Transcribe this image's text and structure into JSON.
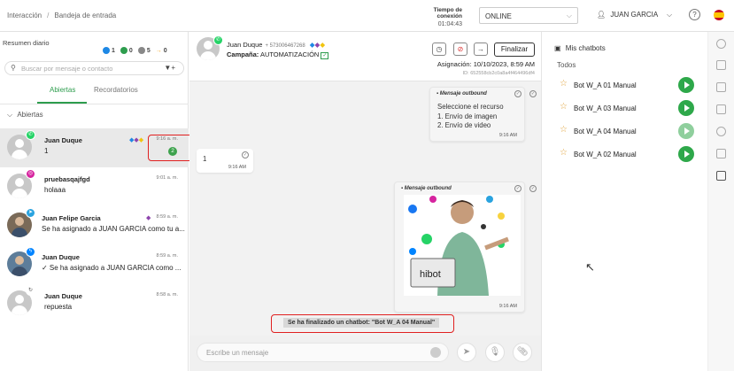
{
  "topbar": {
    "breadcrumb": [
      "Interacción",
      "Bandeja de entrada"
    ],
    "connection_label": "Tiempo de conexión",
    "connection_time": "01:04:43",
    "status": "ONLINE",
    "user": "JUAN GARCIA",
    "help": "?"
  },
  "left": {
    "summary_title": "Resumen diario",
    "counts": [
      {
        "value": "1",
        "color": "#1e88e5"
      },
      {
        "value": "0",
        "color": "#2e9d4e"
      },
      {
        "value": "5",
        "color": "#888888"
      },
      {
        "value": "0",
        "color": "#f5a623"
      }
    ],
    "search_placeholder": "Buscar por mensaje o contacto",
    "tabs": [
      "Abiertas",
      "Recordatorios"
    ],
    "section": "Abiertas",
    "conversations": [
      {
        "name": "Juan Duque",
        "message": "1",
        "time": "9:16 a. m.",
        "channel": "whatsapp",
        "unread": "2"
      },
      {
        "name": "pruebasqajfgd",
        "message": "holaaa",
        "time": "9:01 a. m.",
        "channel": "instagram"
      },
      {
        "name": "Juan Felipe Garcia",
        "message": "Se ha asignado a JUAN GARCIA como tu a...",
        "time": "8:59 a. m.",
        "channel": "telegram"
      },
      {
        "name": "Juan Duque",
        "message": "✓ Se ha asignado a JUAN GARCIA como ...",
        "time": "8:59 a. m.",
        "channel": "messenger"
      },
      {
        "name": "Juan Duque",
        "message": "repuesta",
        "time": "8:58 a. m.",
        "channel": "other"
      }
    ]
  },
  "chat": {
    "contact_name": "Juan Duque",
    "contact_phone": "+ 573006467268",
    "campaign_label": "Campaña:",
    "campaign": "AUTOMATIZACIÓN",
    "finalize": "Finalizar",
    "assignment": "Asignación: 10/10/2023, 8:59 AM",
    "id": "ID: 652558cb2c0a8a4f464496df4",
    "outbound_label": "Mensaje outbound",
    "msg1_lines": [
      "Seleccione el recurso",
      "1. Envío de imagen",
      "2. Envío de video"
    ],
    "msg1_time": "9:16 AM",
    "msg2_text": "1",
    "msg2_time": "9:16 AM",
    "msg3_time": "9:16 AM",
    "image_brand": "hibot",
    "system_message": "Se ha finalizado un chatbot: \"Bot W_A 04 Manual\"",
    "input_placeholder": "Escribe un mensaje"
  },
  "right": {
    "title": "Mis chatbots",
    "filter": "Todos",
    "bots": [
      {
        "name": "Bot W_A 01 Manual",
        "enabled": true
      },
      {
        "name": "Bot W_A 03 Manual",
        "enabled": true
      },
      {
        "name": "Bot W_A 04 Manual",
        "enabled": false
      },
      {
        "name": "Bot W_A 02 Manual",
        "enabled": true
      }
    ]
  }
}
